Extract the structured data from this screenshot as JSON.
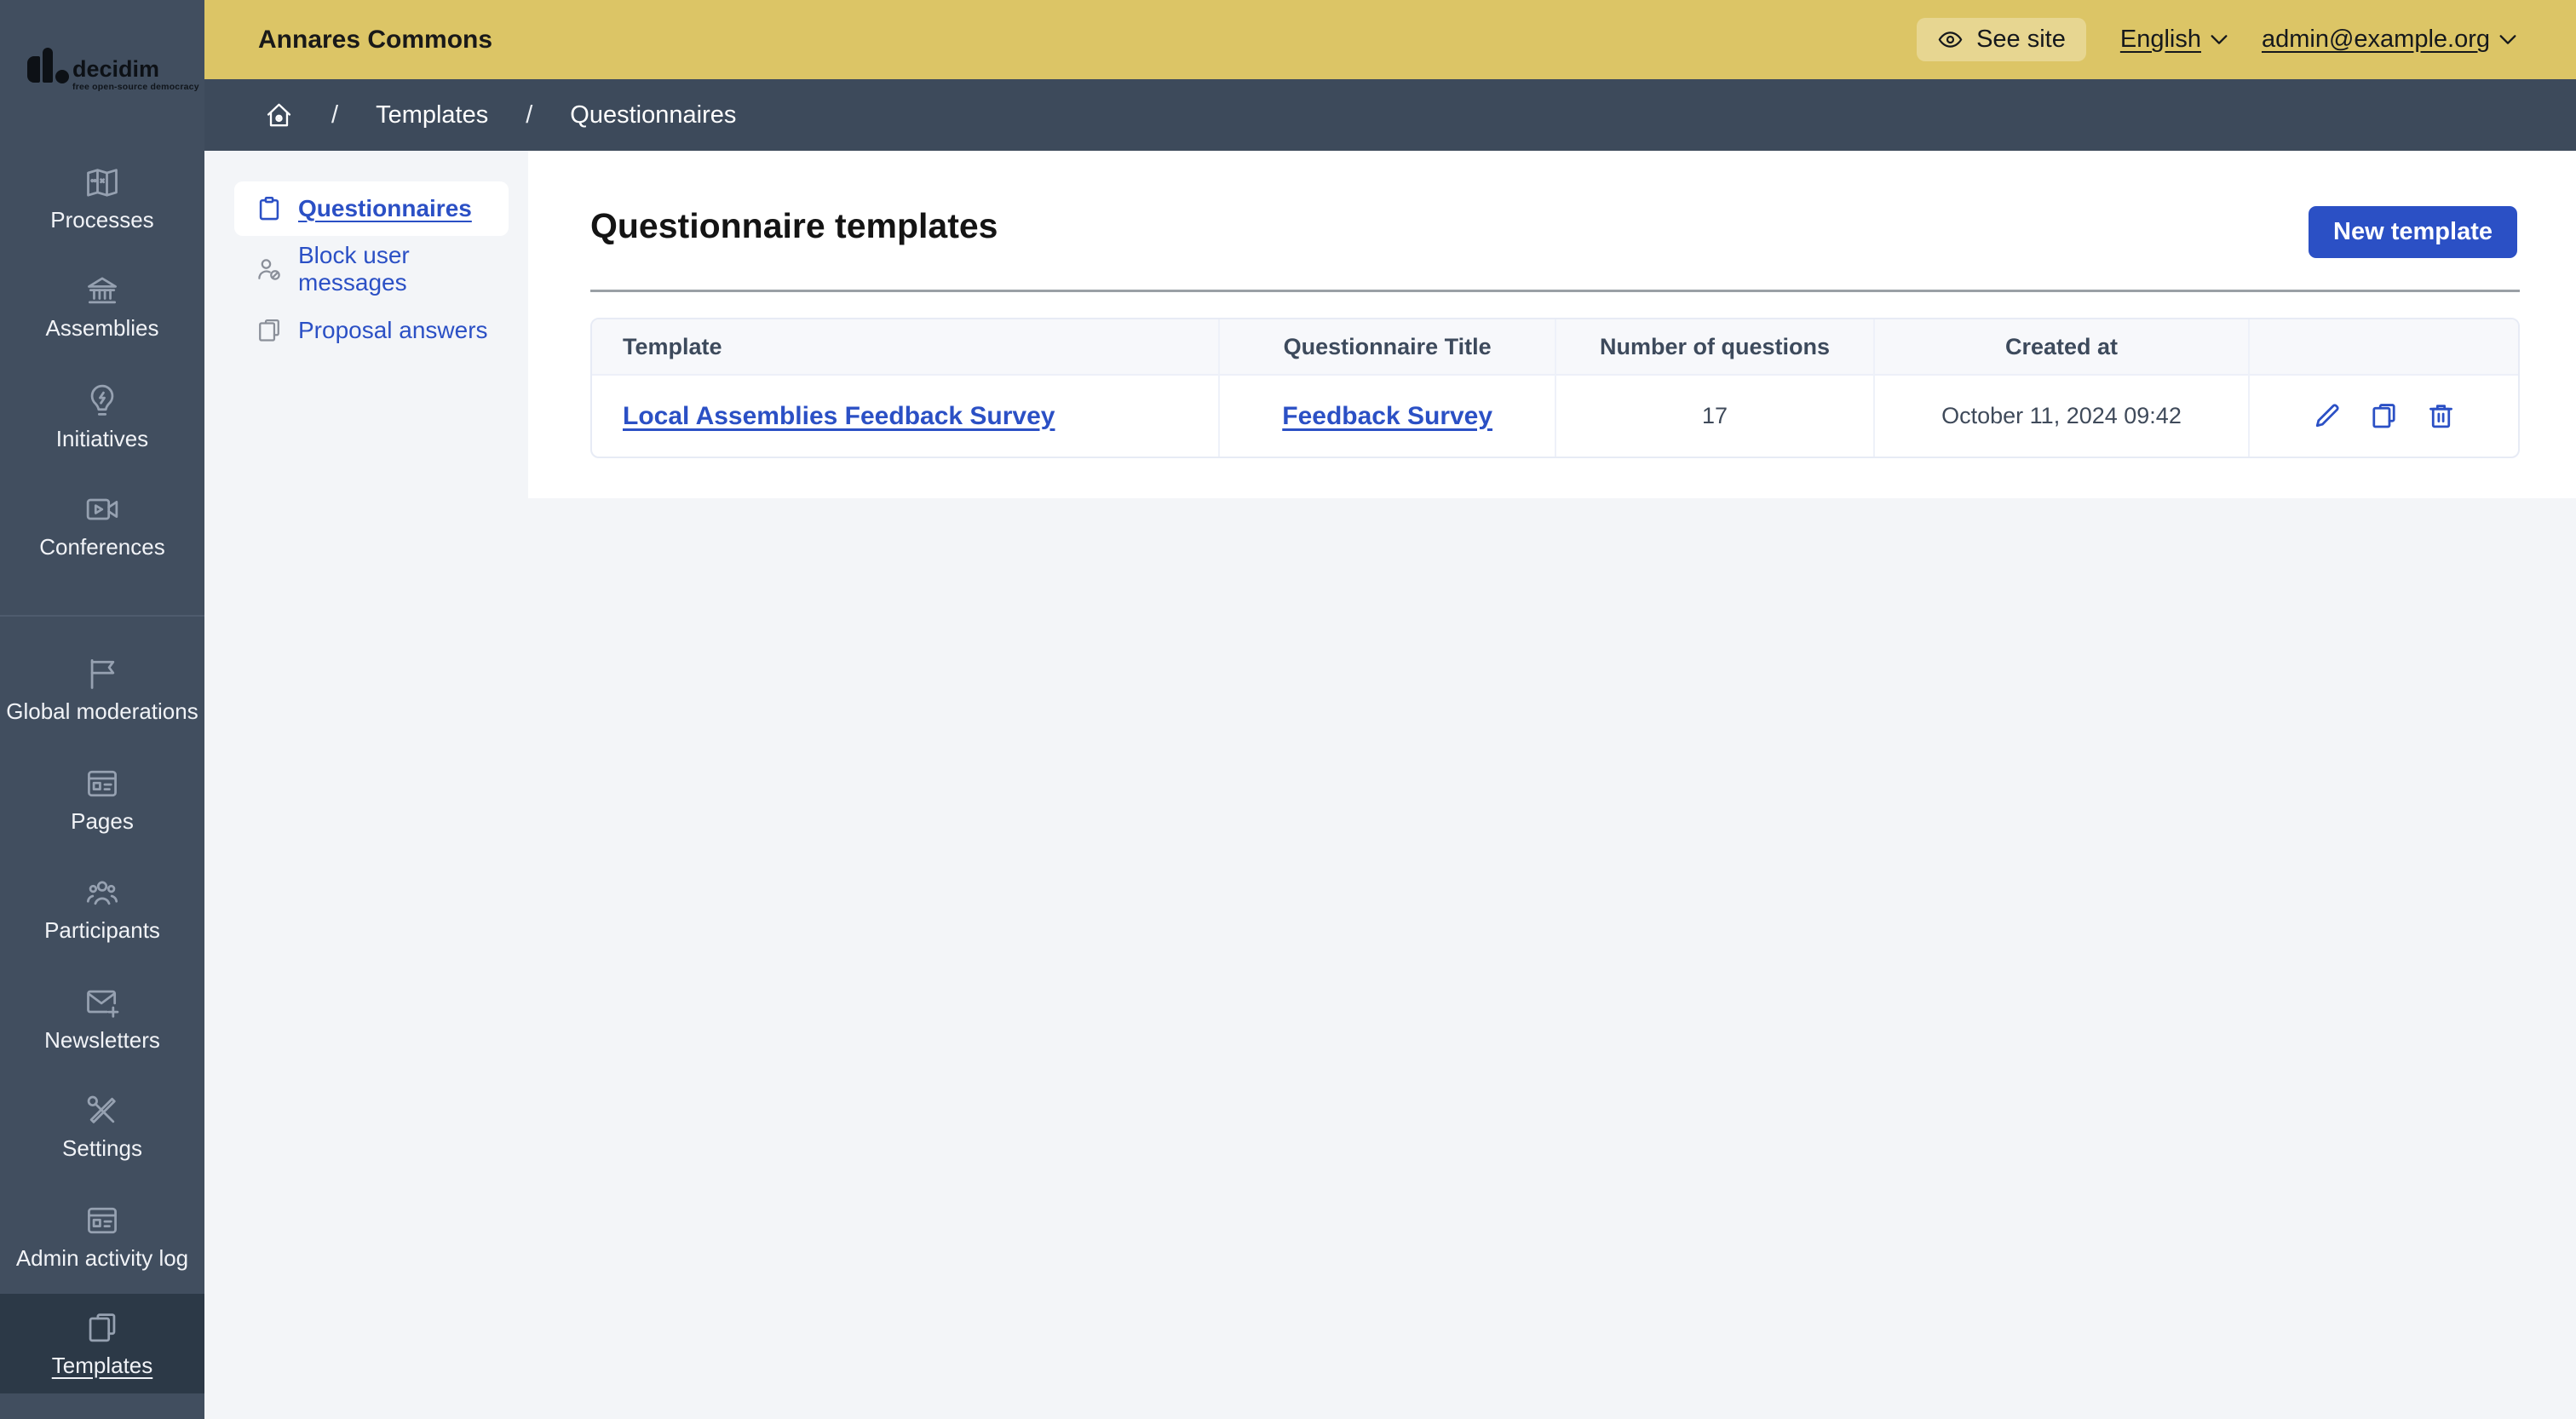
{
  "logo": {
    "brand": "decidim",
    "tagline": "free open-source democracy"
  },
  "topbar": {
    "title": "Annares Commons",
    "see_site_label": "See site",
    "language_label": "English",
    "account_label": "admin@example.org"
  },
  "breadcrumb": {
    "separator": "/",
    "items": [
      "Templates",
      "Questionnaires"
    ]
  },
  "sidebar": {
    "items": [
      {
        "label": "Processes",
        "icon": "map-icon"
      },
      {
        "label": "Assemblies",
        "icon": "bank-icon"
      },
      {
        "label": "Initiatives",
        "icon": "lightbulb-flash-icon"
      },
      {
        "label": "Conferences",
        "icon": "video-camera-icon"
      },
      {
        "label": "Global moderations",
        "icon": "flag-icon"
      },
      {
        "label": "Pages",
        "icon": "window-icon"
      },
      {
        "label": "Participants",
        "icon": "team-icon"
      },
      {
        "label": "Newsletters",
        "icon": "mail-add-icon"
      },
      {
        "label": "Settings",
        "icon": "tools-icon"
      },
      {
        "label": "Admin activity log",
        "icon": "window-icon"
      },
      {
        "label": "Templates",
        "icon": "file-copy-icon"
      }
    ],
    "active_item": "Templates"
  },
  "subnav": {
    "items": [
      {
        "label": "Questionnaires",
        "icon": "clipboard-icon",
        "active": true
      },
      {
        "label": "Block user messages",
        "icon": "user-block-icon",
        "active": false
      },
      {
        "label": "Proposal answers",
        "icon": "file-copy-icon",
        "active": false
      }
    ]
  },
  "main": {
    "title": "Questionnaire templates",
    "new_template_button": "New template",
    "table": {
      "headers": [
        "Template",
        "Questionnaire Title",
        "Number of questions",
        "Created at",
        ""
      ],
      "rows": [
        {
          "template": "Local Assemblies Feedback Survey",
          "questionnaire_title": "Feedback Survey",
          "number_of_questions": "17",
          "created_at": "October 11, 2024 09:42",
          "actions": [
            {
              "name": "edit",
              "icon": "pencil-icon"
            },
            {
              "name": "duplicate",
              "icon": "file-copy-icon"
            },
            {
              "name": "delete",
              "icon": "trash-icon"
            }
          ]
        }
      ]
    }
  },
  "colors": {
    "accent_blue": "#2b50c5",
    "topbar_yellow": "#dcc566",
    "topbar_pill": "#e7d691",
    "sidebar_dark": "#414e5f",
    "sidebar_active": "#2c3947",
    "breadcrumb_dark": "#3d4a5b",
    "content_background": "#f3f5f8",
    "table_border": "#e7ebf5"
  }
}
